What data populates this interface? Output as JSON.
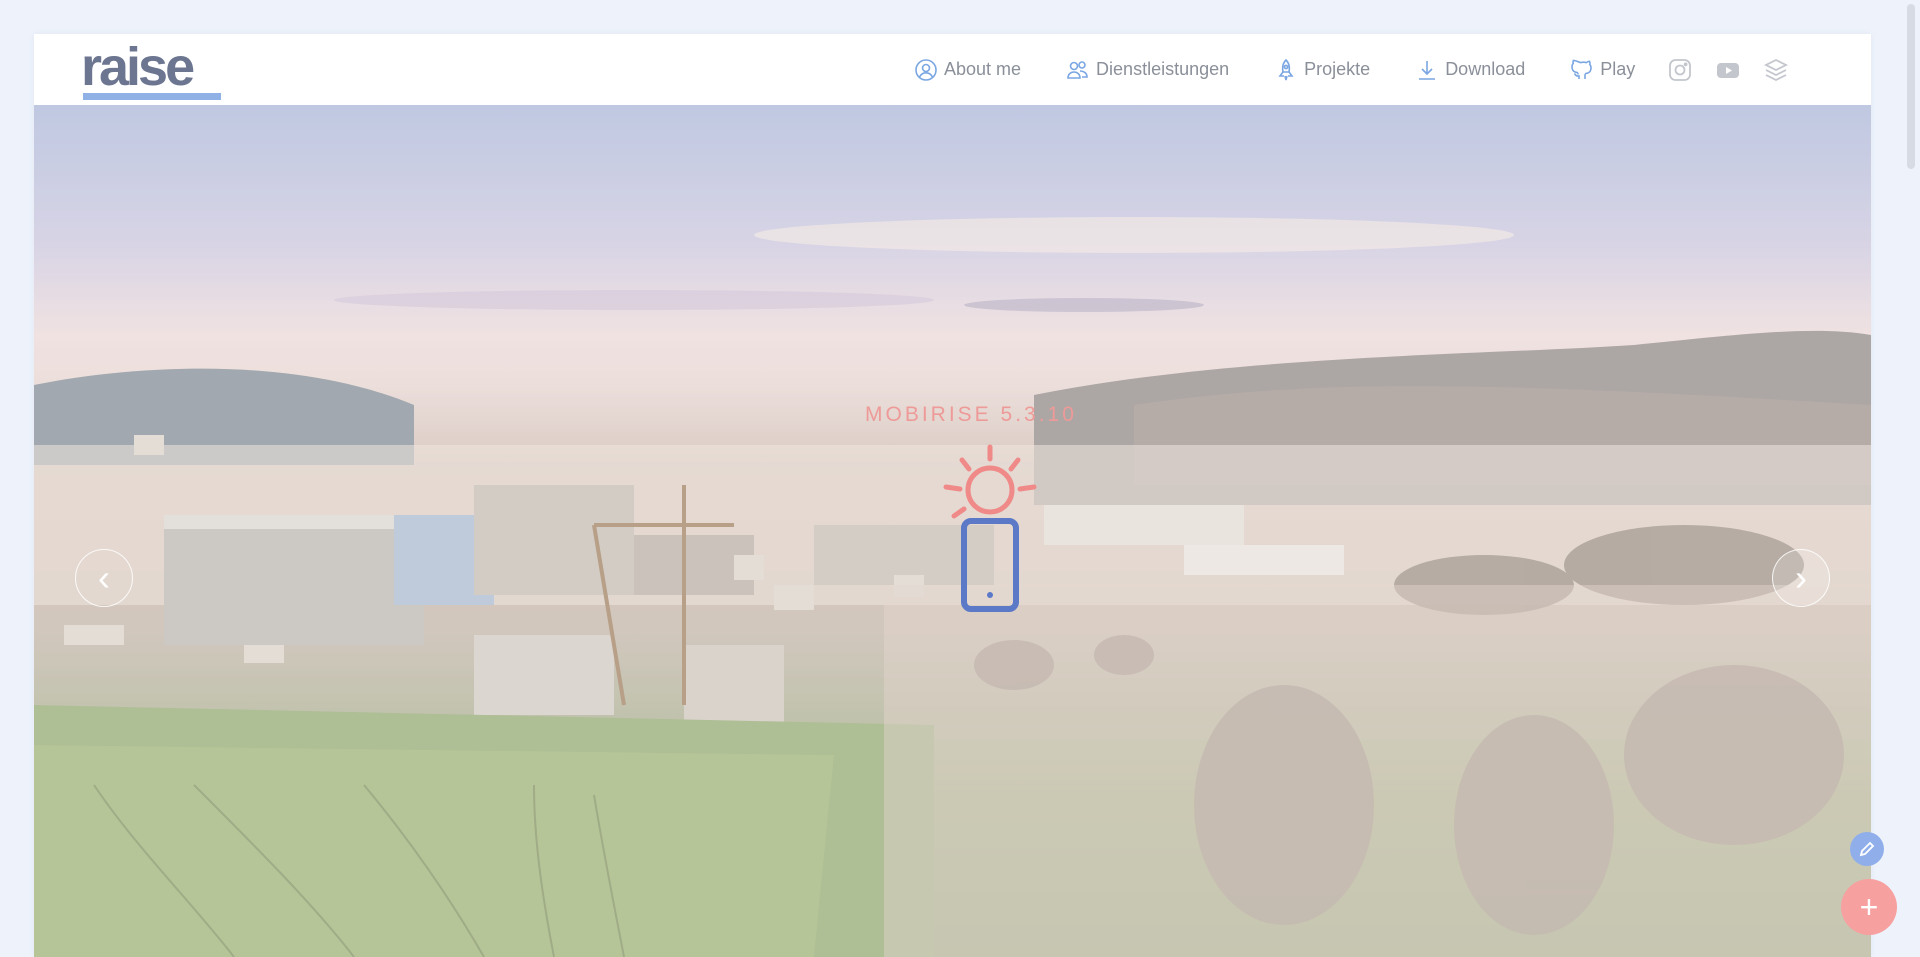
{
  "logo": {
    "text": "raise"
  },
  "nav": {
    "items": [
      {
        "label": "About me",
        "icon": "user-circle-icon"
      },
      {
        "label": "Dienstleistungen",
        "icon": "users-icon"
      },
      {
        "label": "Projekte",
        "icon": "rocket-icon"
      },
      {
        "label": "Download",
        "icon": "download-icon"
      },
      {
        "label": "Play",
        "icon": "github-icon"
      }
    ],
    "social": [
      "instagram-icon",
      "youtube-icon",
      "layers-icon"
    ]
  },
  "hero": {
    "badge": "MOBIRISE  5.3.10",
    "prev_arrow": "‹",
    "next_arrow": "›"
  },
  "fabs": {
    "add_label": "+"
  },
  "colors": {
    "accent_blue": "#8fb1e6",
    "accent_red": "#ee9a98",
    "nav_text": "#8a8f99"
  }
}
